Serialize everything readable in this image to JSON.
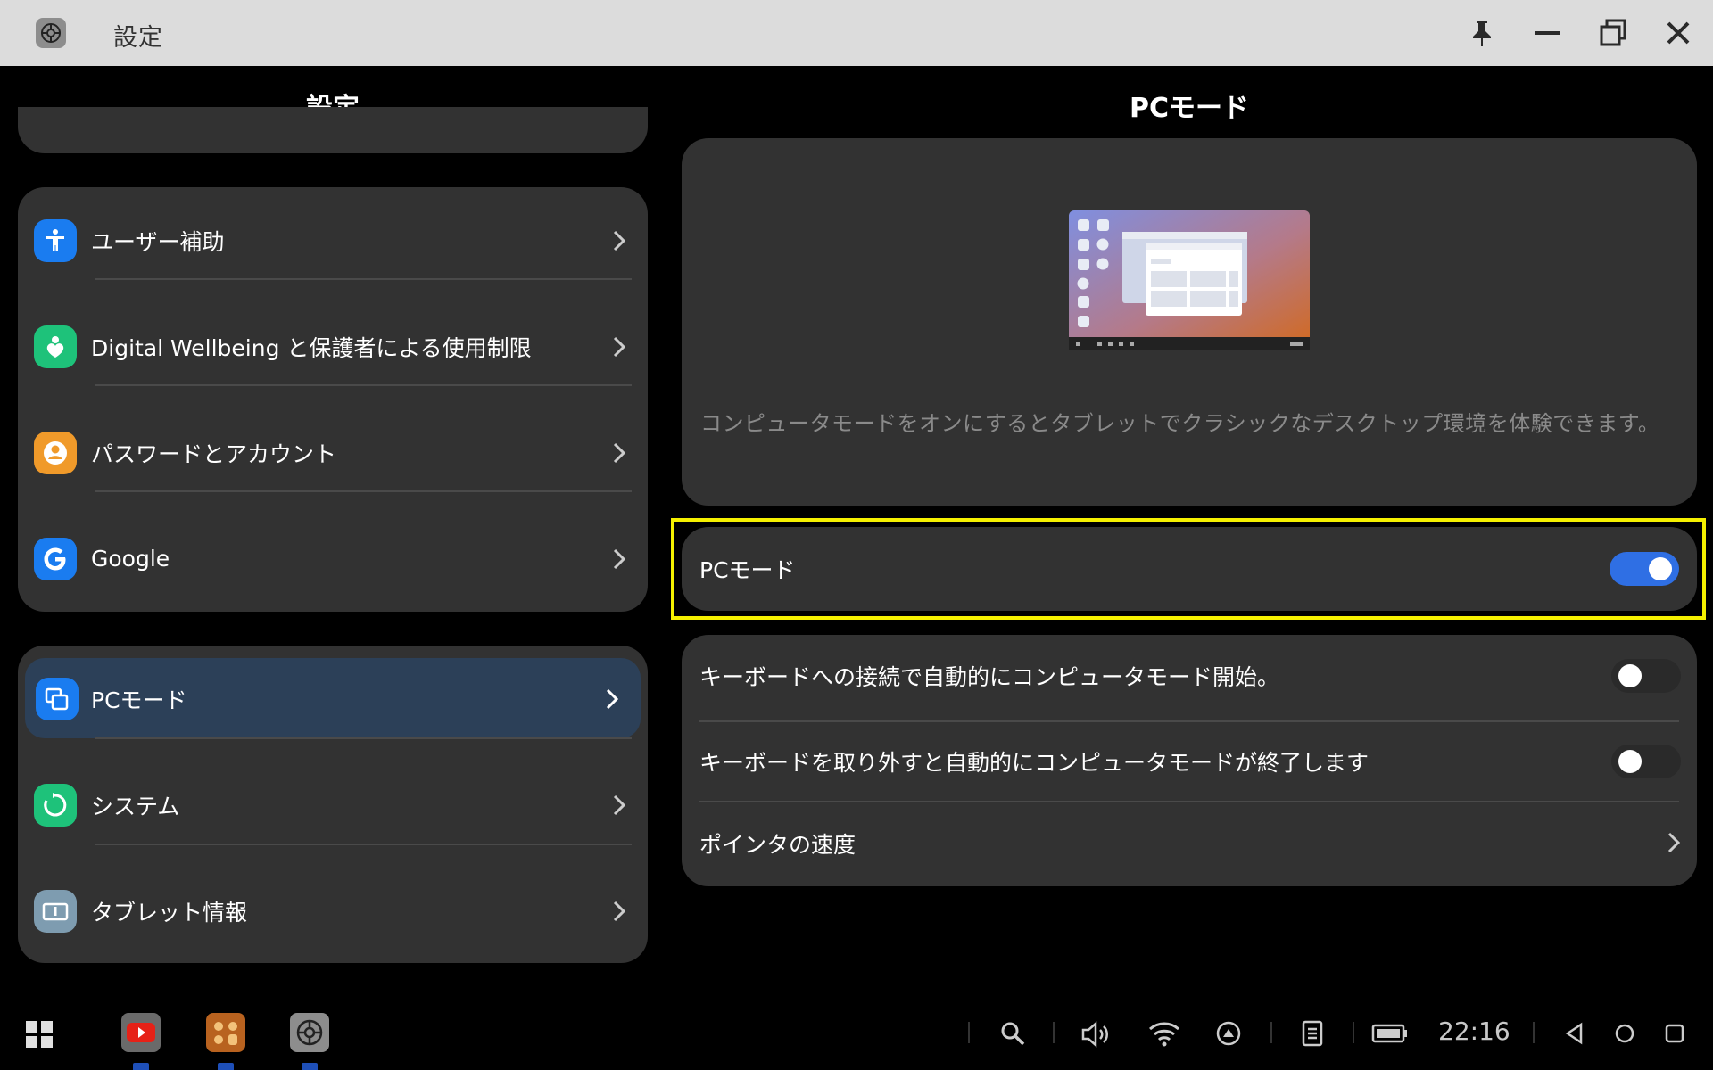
{
  "window": {
    "title": "設定",
    "buttons": [
      "pin",
      "minimize",
      "restore",
      "close"
    ]
  },
  "left_pane": {
    "header": "設定",
    "groups": [
      {
        "items": [
          {
            "label": "ユーザー補助",
            "icon": "accessibility-icon",
            "color": "#1a7cf0"
          },
          {
            "label": "Digital Wellbeing と保護者による使用制限",
            "icon": "wellbeing-icon",
            "color": "#1ec27a"
          },
          {
            "label": "パスワードとアカウント",
            "icon": "account-icon",
            "color": "#f09a2a"
          },
          {
            "label": "Google",
            "icon": "google-icon",
            "color": "#1a7cf0"
          }
        ]
      },
      {
        "items": [
          {
            "label": "PCモード",
            "icon": "pc-mode-icon",
            "color": "#1a7cf0",
            "selected": true
          },
          {
            "label": "システム",
            "icon": "system-icon",
            "color": "#1ec27a"
          },
          {
            "label": "タブレット情報",
            "icon": "tablet-info-icon",
            "color": "#7e9cb0"
          }
        ]
      }
    ]
  },
  "right_pane": {
    "header": "PCモード",
    "description": "コンピュータモードをオンにするとタブレットでクラシックなデスクトップ環境を体験できます。",
    "pc_mode": {
      "label": "PCモード",
      "enabled": true
    },
    "options": [
      {
        "label": "キーボードへの接続で自動的にコンピュータモード開始。",
        "type": "toggle",
        "enabled": false
      },
      {
        "label": "キーボードを取り外すと自動的にコンピュータモードが終了します",
        "type": "toggle",
        "enabled": false
      },
      {
        "label": "ポインタの速度",
        "type": "link"
      }
    ]
  },
  "taskbar": {
    "apps": [
      "app-grid-icon",
      "youtube-icon",
      "calculator-icon",
      "settings-icon"
    ],
    "clock": "22:16"
  },
  "colors": {
    "accent": "#2f6fe4",
    "selected_bg": "#2c4058",
    "card_bg": "#323232",
    "highlight": "#f5f000"
  }
}
